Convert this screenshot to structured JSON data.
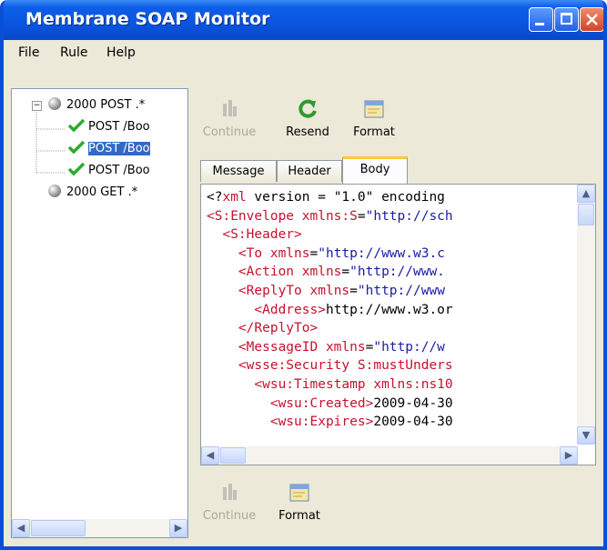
{
  "window": {
    "title": "Membrane SOAP Monitor"
  },
  "menu": [
    "File",
    "Rule",
    "Help"
  ],
  "tree": {
    "rules": [
      {
        "label": "2000 POST .*",
        "expanded": true,
        "children": [
          {
            "label": "POST /Boo"
          },
          {
            "label": "POST /Boo",
            "selected": true
          },
          {
            "label": "POST /Boo"
          }
        ]
      },
      {
        "label": "2000 GET .*"
      }
    ]
  },
  "toolbar": {
    "continue": "Continue",
    "resend": "Resend",
    "format": "Format"
  },
  "tabs": [
    {
      "label": "Message"
    },
    {
      "label": "Header"
    },
    {
      "label": "Body",
      "active": true
    }
  ],
  "code_lines": [
    [
      [
        "x",
        "<?"
      ],
      [
        "t",
        "xml"
      ],
      [
        "x",
        " version = \"1.0\" encoding"
      ]
    ],
    [
      [
        "t",
        "<S:Envelope "
      ],
      [
        "a",
        "xmlns:S"
      ],
      [
        "x",
        "="
      ],
      [
        "v",
        "\"http://sch"
      ]
    ],
    [
      [
        "x",
        "  "
      ],
      [
        "t",
        "<S:Header>"
      ]
    ],
    [
      [
        "x",
        "    "
      ],
      [
        "t",
        "<To "
      ],
      [
        "a",
        "xmlns"
      ],
      [
        "x",
        "="
      ],
      [
        "v",
        "\"http://www.w3.c"
      ]
    ],
    [
      [
        "x",
        "    "
      ],
      [
        "t",
        "<Action "
      ],
      [
        "a",
        "xmlns"
      ],
      [
        "x",
        "="
      ],
      [
        "v",
        "\"http://www."
      ]
    ],
    [
      [
        "x",
        "    "
      ],
      [
        "t",
        "<ReplyTo "
      ],
      [
        "a",
        "xmlns"
      ],
      [
        "x",
        "="
      ],
      [
        "v",
        "\"http://www"
      ]
    ],
    [
      [
        "x",
        "      "
      ],
      [
        "t",
        "<Address>"
      ],
      [
        "x",
        "http://www.w3.or"
      ]
    ],
    [
      [
        "x",
        "    "
      ],
      [
        "t",
        "</ReplyTo>"
      ]
    ],
    [
      [
        "x",
        "    "
      ],
      [
        "t",
        "<MessageID "
      ],
      [
        "a",
        "xmlns"
      ],
      [
        "x",
        "="
      ],
      [
        "v",
        "\"http://w"
      ]
    ],
    [
      [
        "x",
        "    "
      ],
      [
        "t",
        "<wsse:Security "
      ],
      [
        "a",
        "S:mustUnders"
      ]
    ],
    [
      [
        "x",
        "      "
      ],
      [
        "t",
        "<wsu:Timestamp "
      ],
      [
        "a",
        "xmlns:ns10"
      ]
    ],
    [
      [
        "x",
        "        "
      ],
      [
        "t",
        "<wsu:Created>"
      ],
      [
        "x",
        "2009-04-30"
      ]
    ],
    [
      [
        "x",
        "        "
      ],
      [
        "t",
        "<wsu:Expires>"
      ],
      [
        "x",
        "2009-04-30"
      ]
    ]
  ],
  "bottom_toolbar": {
    "continue": "Continue",
    "format": "Format"
  },
  "colors": {
    "title_bar": "#0a55e0",
    "selection": "#316ac5",
    "tag": "#c8102e",
    "value": "#1a1aa6",
    "tab_highlight": "#ffc83c"
  }
}
